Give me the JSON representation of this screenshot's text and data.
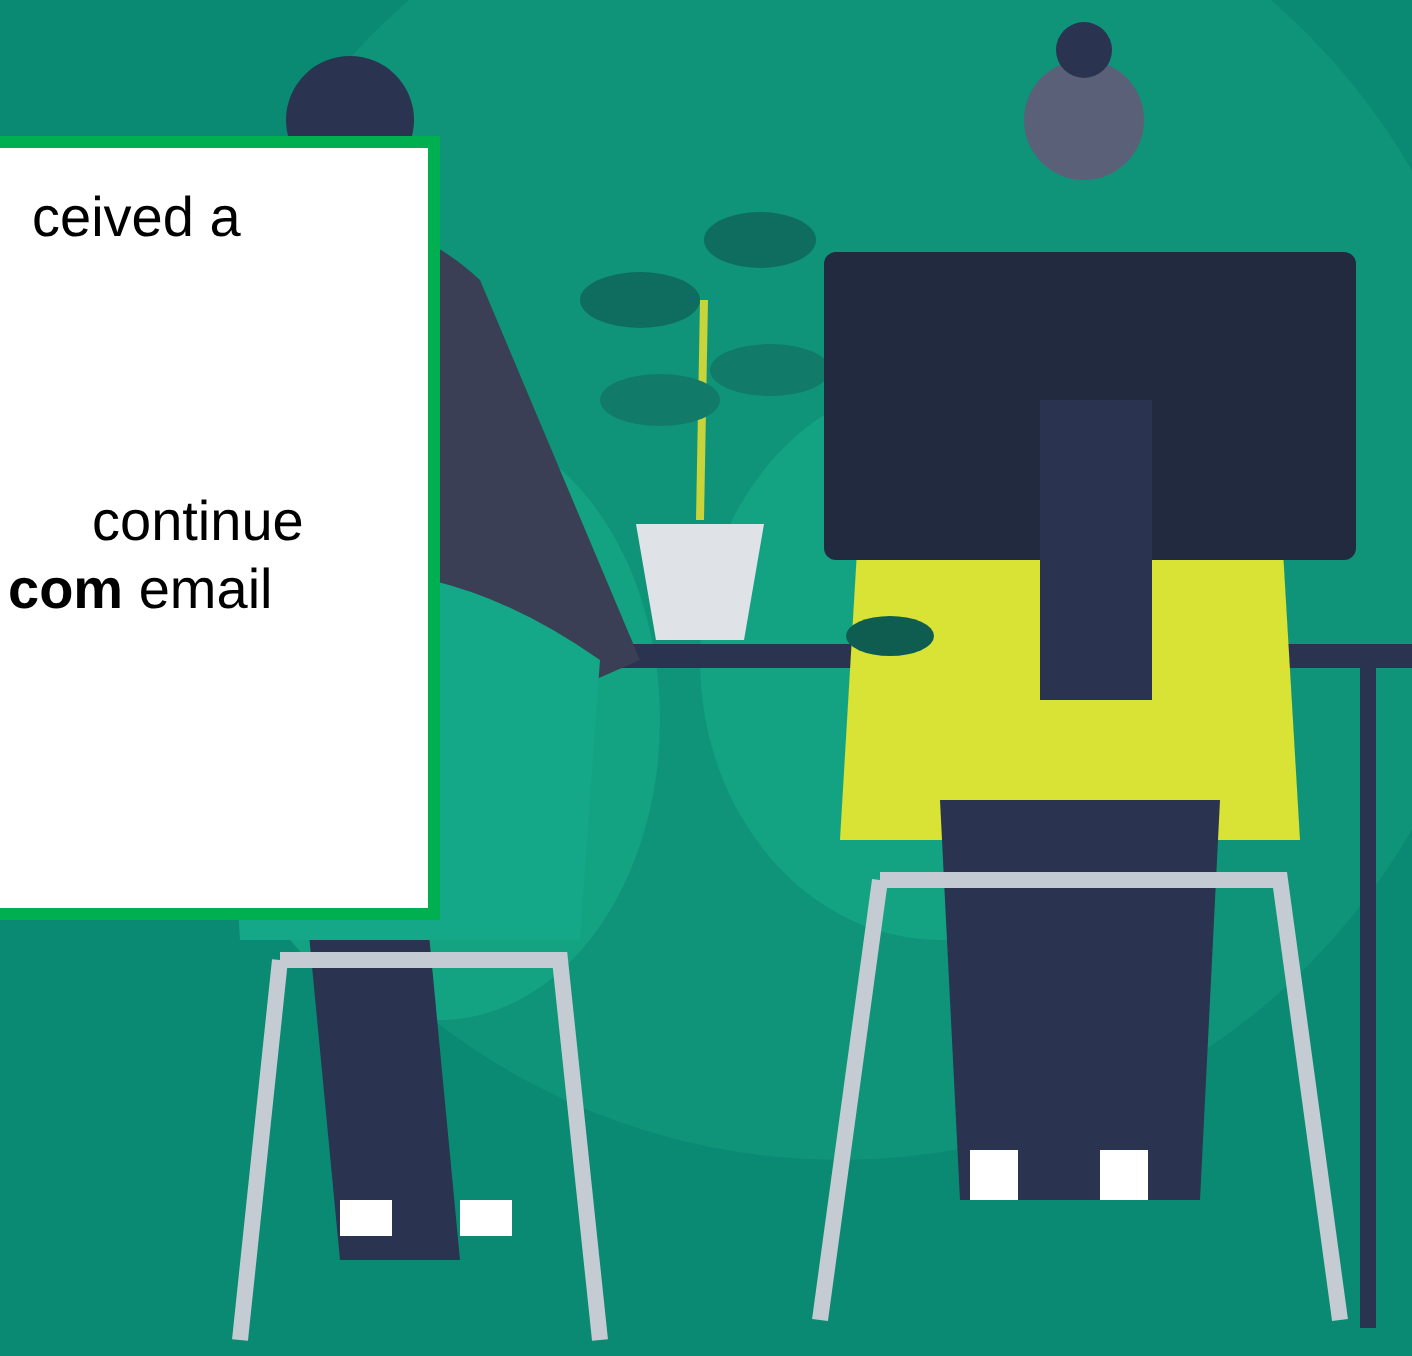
{
  "card": {
    "paragraphs": [
      {
        "lines": [
          "ceived a"
        ]
      },
      {
        "lines": [
          "continue",
          "**com** email"
        ]
      }
    ]
  }
}
